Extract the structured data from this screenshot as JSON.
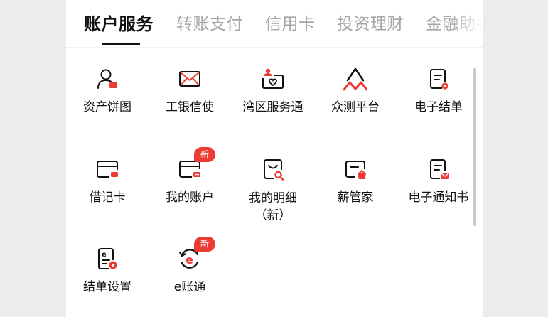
{
  "tabs": [
    {
      "label": "账户服务",
      "active": true
    },
    {
      "label": "转账支付",
      "active": false
    },
    {
      "label": "信用卡",
      "active": false
    },
    {
      "label": "投资理财",
      "active": false
    },
    {
      "label": "金融助手",
      "active": false
    }
  ],
  "grid": {
    "row1": [
      {
        "label": "资产饼图",
        "icon": "person-icon"
      },
      {
        "label": "工银信使",
        "icon": "envelope-icon"
      },
      {
        "label": "湾区服务通",
        "icon": "heart-card-icon"
      },
      {
        "label": "众测平台",
        "icon": "mountain-icon"
      },
      {
        "label": "电子结单",
        "icon": "document-icon"
      }
    ],
    "row2": [
      {
        "label": "借记卡",
        "icon": "debit-card-icon"
      },
      {
        "label": "我的账户",
        "icon": "account-card-icon",
        "badge": "新"
      },
      {
        "label": "我的明细",
        "label2": "（新）",
        "icon": "bag-search-icon"
      },
      {
        "label": "薪管家",
        "icon": "salary-icon"
      },
      {
        "label": "电子通知书",
        "icon": "notice-doc-icon"
      }
    ],
    "row3": [
      {
        "label": "结单设置",
        "icon": "statement-settings-icon"
      },
      {
        "label": "e账通",
        "icon": "e-account-icon",
        "badge": "新"
      }
    ]
  },
  "colors": {
    "accent": "#ee3a34",
    "text": "#111111",
    "inactive_tab": "#a6a6a6"
  }
}
